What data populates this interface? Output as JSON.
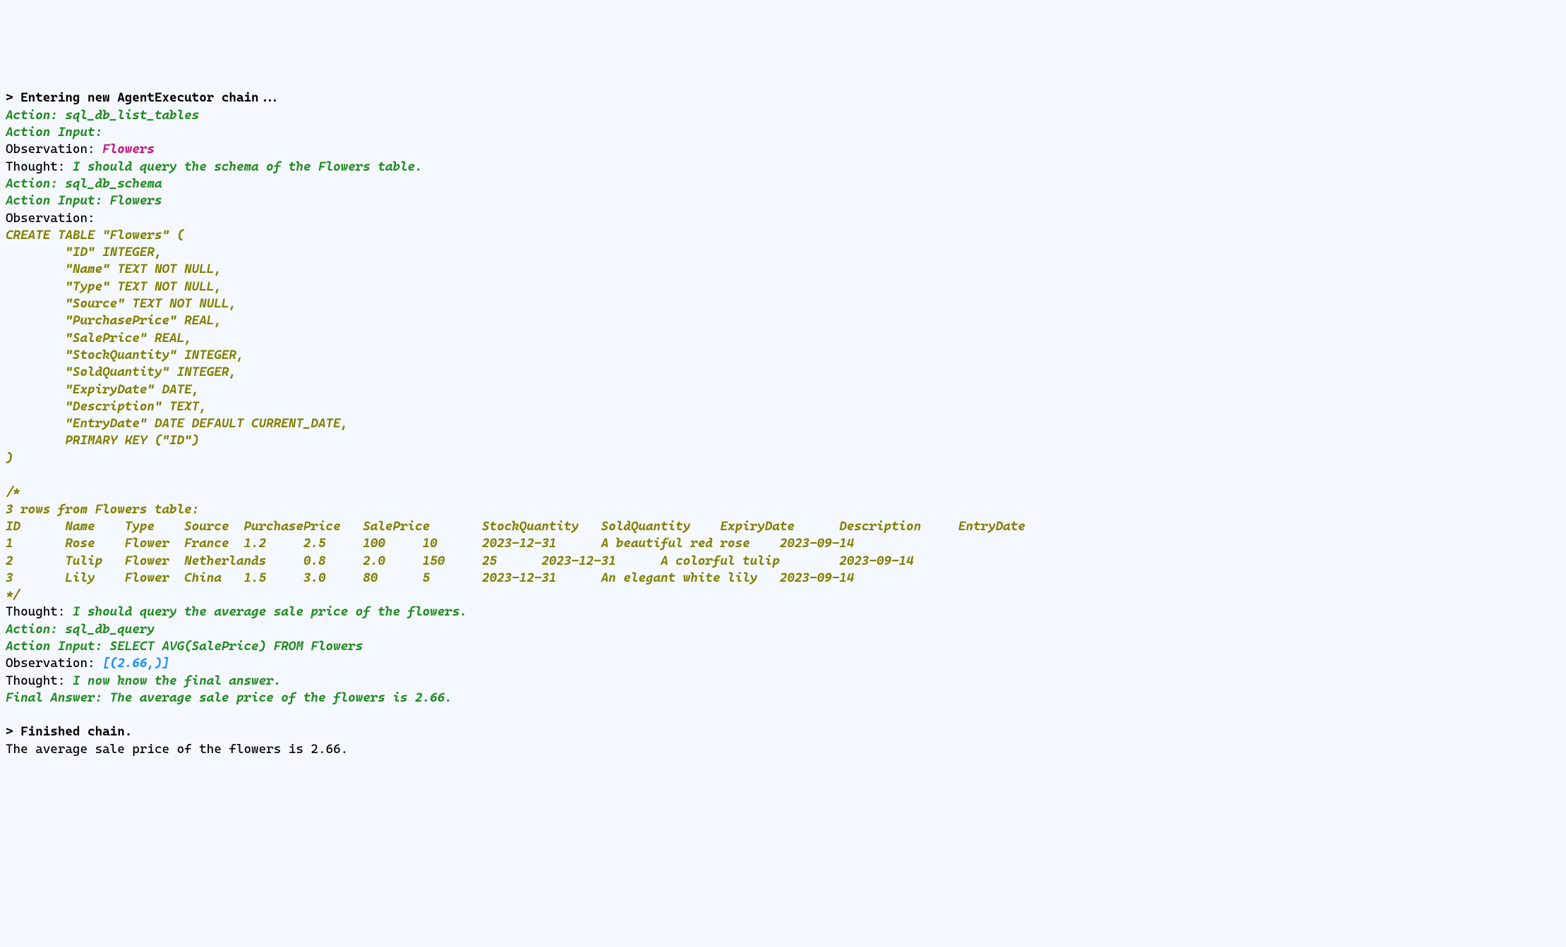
{
  "header": {
    "entering_chain": "> Entering new AgentExecutor chain..."
  },
  "step1": {
    "action_label": "Action: ",
    "action": "sql_db_list_tables",
    "input_label": "Action Input: ",
    "observation_label": "Observation: ",
    "observation": "Flowers",
    "thought_label": "Thought: ",
    "thought": "I should query the schema of the Flowers table."
  },
  "step2": {
    "action_label": "Action: ",
    "action": "sql_db_schema",
    "input_label": "Action Input: ",
    "input": "Flowers",
    "observation_label": "Observation: ",
    "schema": {
      "l0": "CREATE TABLE \"Flowers\" (",
      "l1": "        \"ID\" INTEGER, ",
      "l2": "        \"Name\" TEXT NOT NULL, ",
      "l3": "        \"Type\" TEXT NOT NULL, ",
      "l4": "        \"Source\" TEXT NOT NULL, ",
      "l5": "        \"PurchasePrice\" REAL, ",
      "l6": "        \"SalePrice\" REAL, ",
      "l7": "        \"StockQuantity\" INTEGER, ",
      "l8": "        \"SoldQuantity\" INTEGER, ",
      "l9": "        \"ExpiryDate\" DATE, ",
      "l10": "        \"Description\" TEXT, ",
      "l11": "        \"EntryDate\" DATE DEFAULT CURRENT_DATE, ",
      "l12": "        PRIMARY KEY (\"ID\")",
      "l13": ")",
      "blank": "",
      "comment_open": "/*",
      "rows_header": "3 rows from Flowers table:",
      "cols": "ID      Name    Type    Source  PurchasePrice   SalePrice       StockQuantity   SoldQuantity    ExpiryDate      Description     EntryDate",
      "row1": "1       Rose    Flower  France  1.2     2.5     100     10      2023-12-31      A beautiful red rose    2023-09-14",
      "row2": "2       Tulip   Flower  Netherlands     0.8     2.0     150     25      2023-12-31      A colorful tulip        2023-09-14",
      "row3": "3       Lily    Flower  China   1.5     3.0     80      5       2023-12-31      An elegant white lily   2023-09-14",
      "comment_close": "*/"
    }
  },
  "step3": {
    "thought_label": "Thought: ",
    "thought": "I should query the average sale price of the flowers.",
    "action_label": "Action: ",
    "action": "sql_db_query",
    "input_label": "Action Input: ",
    "input": "SELECT AVG(SalePrice) FROM Flowers",
    "observation_label": "Observation: ",
    "observation": "[(2.66,)]"
  },
  "final": {
    "thought_label": "Thought: ",
    "thought": "I now know the final answer.",
    "answer_label": "Final Answer: ",
    "answer": "The average sale price of the flowers is 2.66."
  },
  "footer": {
    "blank": "",
    "finished": "> Finished chain.",
    "result": "The average sale price of the flowers is 2.66."
  }
}
